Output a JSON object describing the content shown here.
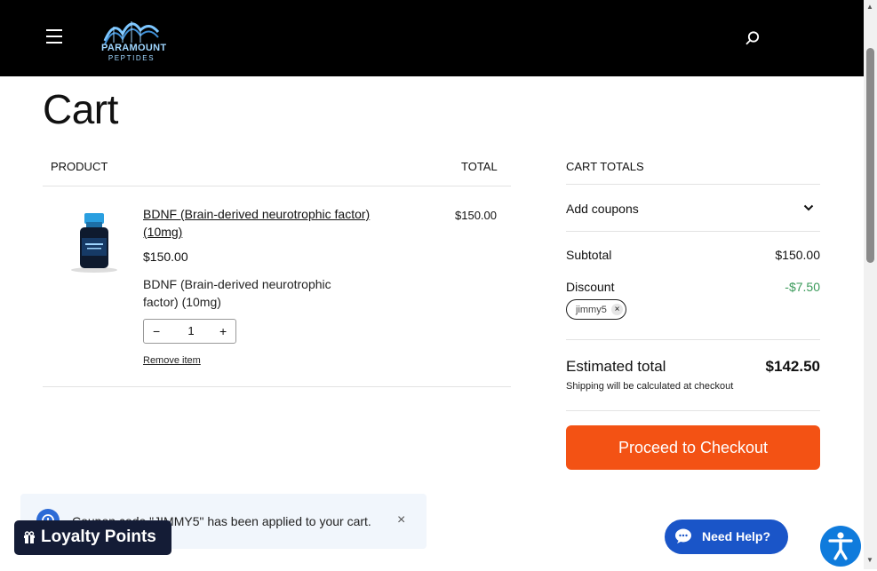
{
  "header": {
    "logo_text": "PARAMOUNT",
    "logo_sub": "PEPTIDES"
  },
  "page": {
    "title": "Cart"
  },
  "cart": {
    "col_product": "PRODUCT",
    "col_total": "TOTAL",
    "items": [
      {
        "name": "BDNF (Brain-derived neurotrophic factor) (10mg)",
        "price": "$150.00",
        "description": "BDNF (Brain-derived neurotrophic factor) (10mg)",
        "quantity": "1",
        "minus": "−",
        "plus": "+",
        "remove_label": "Remove item",
        "line_total": "$150.00"
      }
    ]
  },
  "totals": {
    "title": "CART TOTALS",
    "add_coupons": "Add coupons",
    "subtotal_label": "Subtotal",
    "subtotal_value": "$150.00",
    "discount_label": "Discount",
    "discount_value": "-$7.50",
    "coupon_code": "jimmy5",
    "coupon_remove": "×",
    "estimated_label": "Estimated total",
    "estimated_value": "$142.50",
    "shipping_note": "Shipping will be calculated at checkout",
    "checkout_label": "Proceed to Checkout"
  },
  "notice": {
    "text": "Coupon code \"JIMMY5\" has been applied to your cart.",
    "close": "×"
  },
  "widgets": {
    "loyalty_label": "Loyalty Points",
    "help_label": "Need Help?"
  },
  "colors": {
    "header_bg": "#000000",
    "checkout_bg": "#f35214",
    "discount": "#3a9a5a",
    "loyalty_bg": "#141c36",
    "help_bg": "#1a55c8",
    "a11y_bg": "#0f7bdc"
  },
  "icons": {
    "menu": "hamburger-icon",
    "search": "search-icon",
    "chevron": "chevron-down-icon",
    "gift": "gift-icon",
    "chat": "chat-icon",
    "accessibility": "accessibility-icon"
  }
}
